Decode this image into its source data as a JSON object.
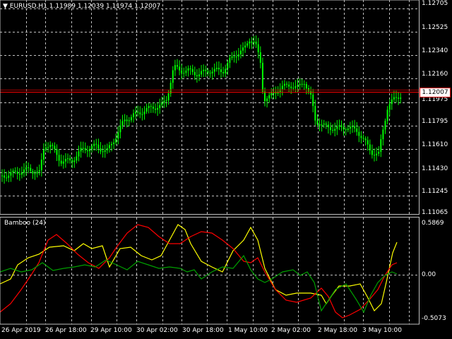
{
  "chart": {
    "symbol_timeframe": "EURUSD,H1",
    "ohlc": [
      "1.11989",
      "1.12039",
      "1.11974",
      "1.12007"
    ],
    "current_price": "1.12007",
    "price_ticks": [
      "1.12705",
      "1.12525",
      "1.12340",
      "1.12160",
      "1.11975",
      "1.11795",
      "1.11610",
      "1.11430",
      "1.11245",
      "1.11065"
    ],
    "indicator": {
      "name": "Bamboo (24)",
      "ticks": [
        "0.5869",
        "0.00",
        "-0.5073"
      ]
    },
    "time_ticks": [
      "26 Apr 2019",
      "26 Apr 18:00",
      "29 Apr 10:00",
      "30 Apr 02:00",
      "30 Apr 18:00",
      "1 May 10:00",
      "2 May 02:00",
      "2 May 18:00",
      "3 May 10:00"
    ],
    "colors": {
      "background": "#000000",
      "candle": "#00ff00",
      "grid": "#c0c0c0",
      "price_line": "#ff0000",
      "ind_yellow": "#ffff00",
      "ind_red": "#ff0000",
      "ind_green": "#00a000"
    }
  }
}
